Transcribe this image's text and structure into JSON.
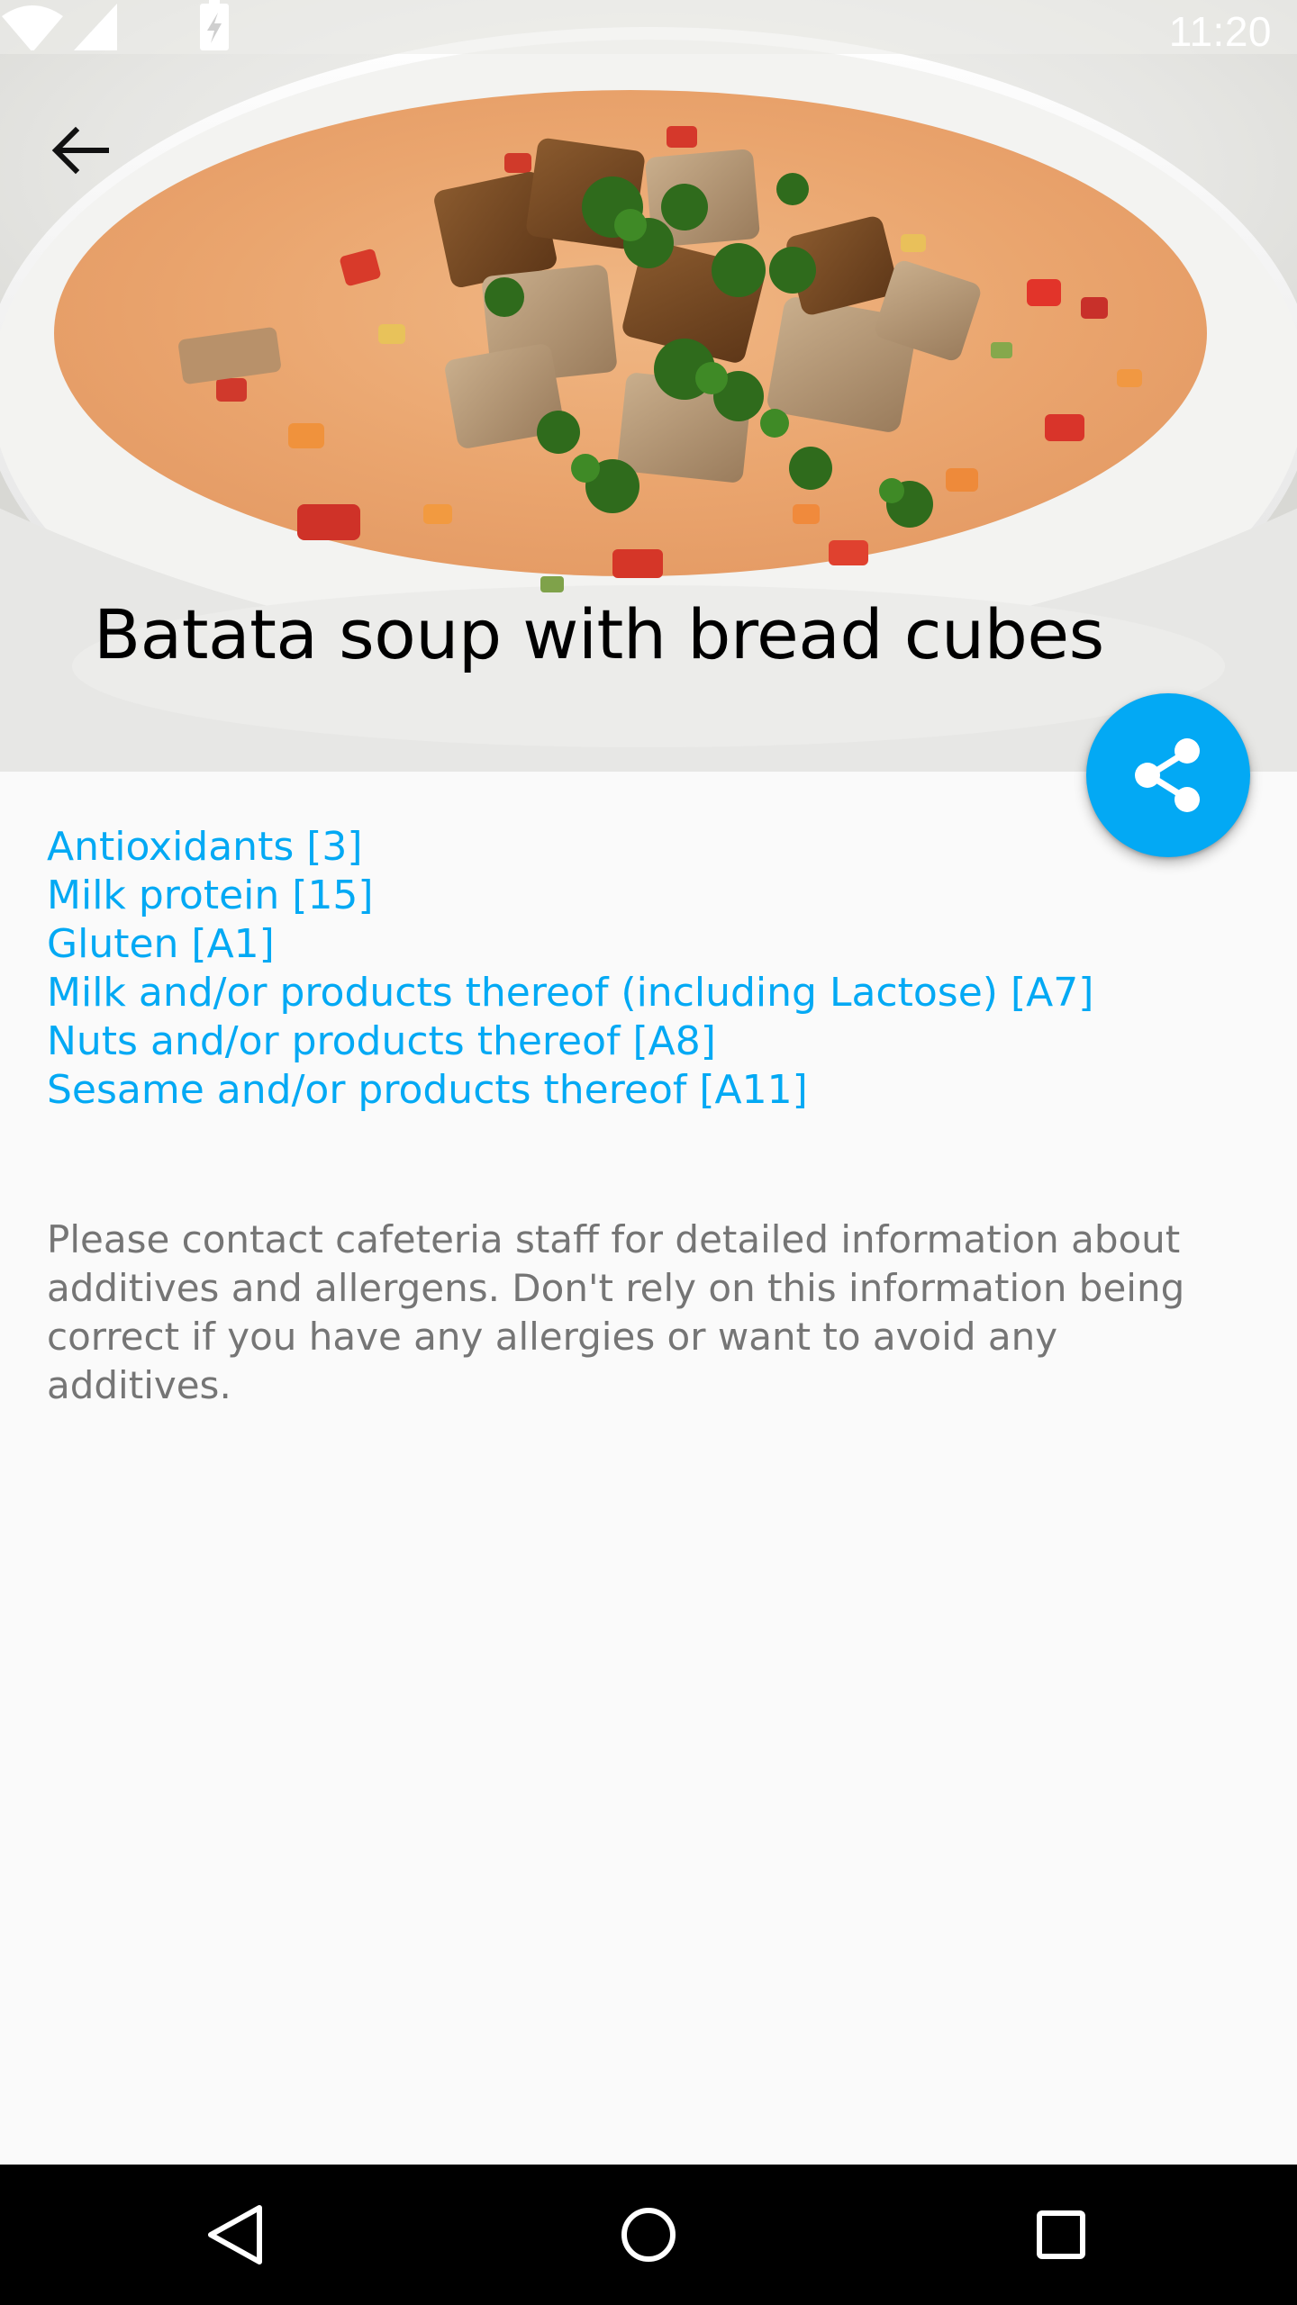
{
  "status_bar": {
    "time": "11:20",
    "icons": [
      "wifi-icon",
      "cell-signal-icon",
      "battery-charging-icon"
    ]
  },
  "toolbar": {
    "back_icon": "arrow-back-icon"
  },
  "recipe": {
    "title": "Batata soup with bread cubes",
    "image_subject": "bowl of soup with bread cubes and parsley"
  },
  "fab": {
    "icon": "share-icon",
    "color": "#03a9f4"
  },
  "tags": [
    "Antioxidants [3]",
    "Milk protein [15]",
    "Gluten [A1]",
    "Milk and/or products thereof (including Lactose) [A7]",
    "Nuts and/or products thereof [A8]",
    "Sesame and/or products thereof [A11]"
  ],
  "disclaimer": "Please contact cafeteria staff for detailed information about additives and allergens. Don't rely on this information being correct if you have any allergies or want to avoid any additives.",
  "nav_bar": {
    "buttons": [
      "nav-back-icon",
      "nav-home-icon",
      "nav-recents-icon"
    ]
  },
  "colors": {
    "accent": "#03a9f4",
    "text_secondary": "#757575",
    "background": "#fafafa"
  }
}
